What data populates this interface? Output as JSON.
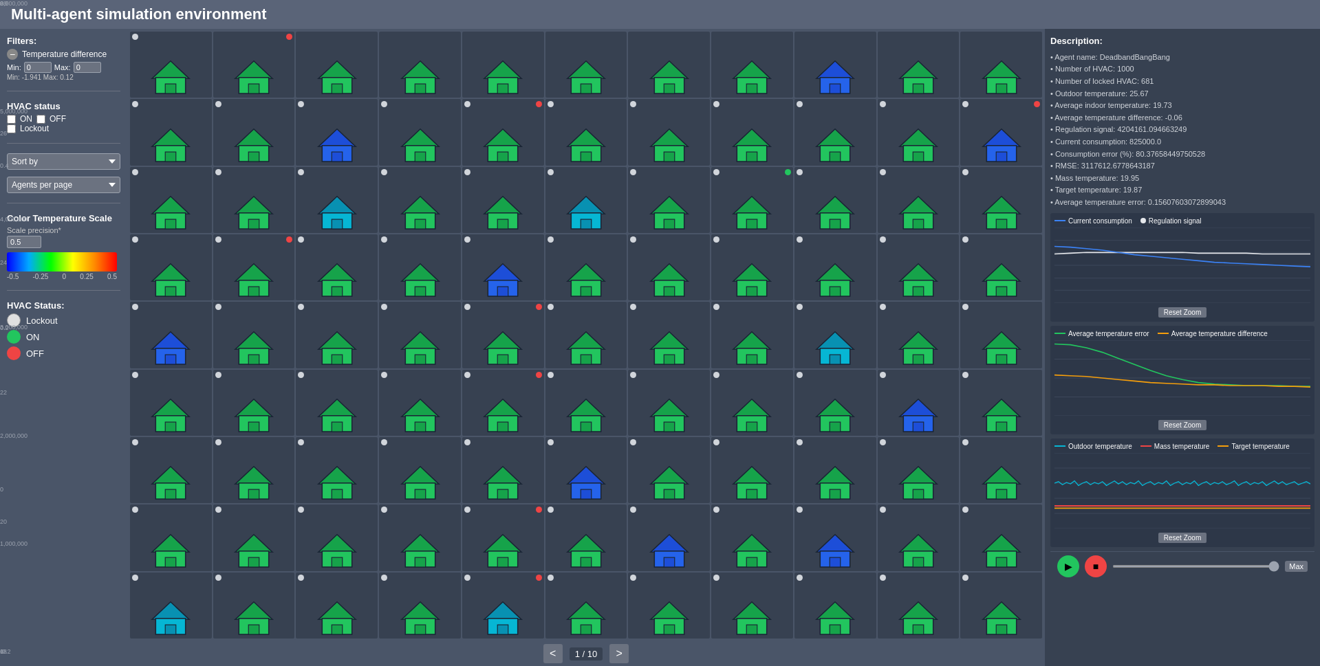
{
  "app": {
    "title": "Multi-agent simulation environment"
  },
  "filters": {
    "title": "Filters:",
    "temp_diff_label": "Temperature difference",
    "min_label": "Min:",
    "max_label": "Max:",
    "min_value": "0",
    "max_value": "0",
    "range_text": "Min: -1.941  Max: 0.12",
    "hvac_status_label": "HVAC status",
    "on_label": "ON",
    "off_label": "OFF",
    "lockout_label": "Lockout"
  },
  "sort": {
    "label": "Sort by",
    "placeholder": "Sort by"
  },
  "agents_per_page": {
    "label": "Agents per page",
    "placeholder": "Agents per page"
  },
  "color_scale": {
    "title": "Color Temperature Scale",
    "precision_label": "Scale precision*",
    "precision_value": "0.5",
    "scale_min": "-0.5",
    "scale_minus_quarter": "-0.25",
    "scale_zero": "0",
    "scale_quarter": "0.25",
    "scale_max": "0.5"
  },
  "hvac_status": {
    "title": "HVAC Status:",
    "lockout_label": "Lockout",
    "on_label": "ON",
    "off_label": "OFF"
  },
  "description": {
    "title": "Description:",
    "items": [
      "Agent name: DeadbandBangBang",
      "Number of HVAC: 1000",
      "Number of locked HVAC: 681",
      "Outdoor temperature: 25.67",
      "Average indoor temperature: 19.73",
      "Average temperature difference: -0.06",
      "Regulation signal: 4204161.094663249",
      "Current consumption: 825000.0",
      "Consumption error (%): 80.37658449750528",
      "RMSE: 3117612.6778643187",
      "Mass temperature: 19.95",
      "Target temperature: 19.87",
      "Average temperature error: 0.15607603072899043"
    ]
  },
  "chart1": {
    "legend": [
      {
        "label": "Current consumption",
        "color": "#3b82f6",
        "type": "line"
      },
      {
        "label": "Regulation signal",
        "color": "#e5e7eb",
        "type": "square"
      }
    ],
    "y_labels": [
      "6,000,000",
      "5,000,000",
      "4,000,000",
      "3,000,000",
      "2,000,000",
      "1,000,000",
      "0"
    ],
    "reset_zoom": "Reset Zoom"
  },
  "chart2": {
    "legend": [
      {
        "label": "Average temperature error",
        "color": "#22c55e",
        "type": "line"
      },
      {
        "label": "Average temperature difference",
        "color": "#f59e0b",
        "type": "line"
      }
    ],
    "y_labels": [
      "0.6",
      "0.4",
      "0.2",
      "0",
      "-0.2"
    ],
    "reset_zoom": "Reset Zoom"
  },
  "chart3": {
    "legend": [
      {
        "label": "Outdoor temperature",
        "color": "#06b6d4",
        "type": "line"
      },
      {
        "label": "Mass temperature",
        "color": "#ef4444",
        "type": "line"
      },
      {
        "label": "Target temperature",
        "color": "#f59e0b",
        "type": "line"
      }
    ],
    "y_labels": [
      "28",
      "26",
      "24",
      "22",
      "20",
      "18"
    ],
    "reset_zoom": "Reset Zoom"
  },
  "pagination": {
    "prev": "<",
    "next": ">",
    "current": "1",
    "total": "10",
    "separator": "/"
  },
  "playback": {
    "play_icon": "▶",
    "stop_icon": "■",
    "speed_label": "Max"
  },
  "grid": {
    "rows": 9,
    "cols": 11,
    "cells": [
      {
        "dot_left": "white",
        "dot_right": "none",
        "color": "green"
      },
      {
        "dot_left": "none",
        "dot_right": "red",
        "color": "green"
      },
      {
        "dot_left": "none",
        "dot_right": "none",
        "color": "green"
      },
      {
        "dot_left": "none",
        "dot_right": "none",
        "color": "green"
      },
      {
        "dot_left": "none",
        "dot_right": "none",
        "color": "green"
      },
      {
        "dot_left": "none",
        "dot_right": "none",
        "color": "green"
      },
      {
        "dot_left": "none",
        "dot_right": "none",
        "color": "green"
      },
      {
        "dot_left": "none",
        "dot_right": "none",
        "color": "green"
      },
      {
        "dot_left": "none",
        "dot_right": "none",
        "color": "blue"
      },
      {
        "dot_left": "none",
        "dot_right": "none",
        "color": "green"
      },
      {
        "dot_left": "none",
        "dot_right": "none",
        "color": "green"
      },
      {
        "dot_left": "white",
        "dot_right": "none",
        "color": "green"
      },
      {
        "dot_left": "white",
        "dot_right": "none",
        "color": "green"
      },
      {
        "dot_left": "white",
        "dot_right": "none",
        "color": "blue"
      },
      {
        "dot_left": "white",
        "dot_right": "none",
        "color": "green"
      },
      {
        "dot_left": "white",
        "dot_right": "red",
        "color": "green"
      },
      {
        "dot_left": "white",
        "dot_right": "none",
        "color": "green"
      },
      {
        "dot_left": "white",
        "dot_right": "none",
        "color": "green"
      },
      {
        "dot_left": "white",
        "dot_right": "none",
        "color": "green"
      },
      {
        "dot_left": "white",
        "dot_right": "none",
        "color": "green"
      },
      {
        "dot_left": "white",
        "dot_right": "none",
        "color": "green"
      },
      {
        "dot_left": "white",
        "dot_right": "red",
        "color": "blue"
      },
      {
        "dot_left": "white",
        "dot_right": "none",
        "color": "green"
      },
      {
        "dot_left": "white",
        "dot_right": "none",
        "color": "green"
      },
      {
        "dot_left": "white",
        "dot_right": "none",
        "color": "cyan"
      },
      {
        "dot_left": "white",
        "dot_right": "none",
        "color": "green"
      },
      {
        "dot_left": "white",
        "dot_right": "none",
        "color": "green"
      },
      {
        "dot_left": "white",
        "dot_right": "none",
        "color": "cyan"
      },
      {
        "dot_left": "white",
        "dot_right": "none",
        "color": "green"
      },
      {
        "dot_left": "white",
        "dot_right": "green",
        "color": "green"
      },
      {
        "dot_left": "white",
        "dot_right": "none",
        "color": "green"
      },
      {
        "dot_left": "white",
        "dot_right": "none",
        "color": "green"
      },
      {
        "dot_left": "white",
        "dot_right": "none",
        "color": "green"
      },
      {
        "dot_left": "white",
        "dot_right": "none",
        "color": "green"
      },
      {
        "dot_left": "white",
        "dot_right": "red",
        "color": "green"
      },
      {
        "dot_left": "white",
        "dot_right": "none",
        "color": "green"
      },
      {
        "dot_left": "white",
        "dot_right": "none",
        "color": "green"
      },
      {
        "dot_left": "white",
        "dot_right": "none",
        "color": "blue"
      },
      {
        "dot_left": "white",
        "dot_right": "none",
        "color": "green"
      },
      {
        "dot_left": "white",
        "dot_right": "none",
        "color": "green"
      },
      {
        "dot_left": "white",
        "dot_right": "none",
        "color": "green"
      },
      {
        "dot_left": "white",
        "dot_right": "none",
        "color": "green"
      },
      {
        "dot_left": "white",
        "dot_right": "none",
        "color": "green"
      },
      {
        "dot_left": "white",
        "dot_right": "none",
        "color": "green"
      },
      {
        "dot_left": "white",
        "dot_right": "none",
        "color": "blue"
      },
      {
        "dot_left": "white",
        "dot_right": "none",
        "color": "green"
      },
      {
        "dot_left": "white",
        "dot_right": "none",
        "color": "green"
      },
      {
        "dot_left": "white",
        "dot_right": "none",
        "color": "green"
      },
      {
        "dot_left": "white",
        "dot_right": "red",
        "color": "green"
      },
      {
        "dot_left": "white",
        "dot_right": "none",
        "color": "green"
      },
      {
        "dot_left": "white",
        "dot_right": "none",
        "color": "green"
      },
      {
        "dot_left": "white",
        "dot_right": "none",
        "color": "green"
      },
      {
        "dot_left": "white",
        "dot_right": "none",
        "color": "cyan"
      },
      {
        "dot_left": "white",
        "dot_right": "none",
        "color": "green"
      },
      {
        "dot_left": "white",
        "dot_right": "none",
        "color": "green"
      },
      {
        "dot_left": "white",
        "dot_right": "none",
        "color": "green"
      },
      {
        "dot_left": "white",
        "dot_right": "none",
        "color": "green"
      },
      {
        "dot_left": "white",
        "dot_right": "none",
        "color": "green"
      },
      {
        "dot_left": "white",
        "dot_right": "none",
        "color": "green"
      },
      {
        "dot_left": "white",
        "dot_right": "red",
        "color": "green"
      },
      {
        "dot_left": "white",
        "dot_right": "none",
        "color": "green"
      },
      {
        "dot_left": "white",
        "dot_right": "none",
        "color": "green"
      },
      {
        "dot_left": "white",
        "dot_right": "none",
        "color": "green"
      },
      {
        "dot_left": "white",
        "dot_right": "none",
        "color": "green"
      },
      {
        "dot_left": "white",
        "dot_right": "none",
        "color": "blue"
      },
      {
        "dot_left": "white",
        "dot_right": "none",
        "color": "green"
      },
      {
        "dot_left": "white",
        "dot_right": "none",
        "color": "green"
      },
      {
        "dot_left": "white",
        "dot_right": "none",
        "color": "green"
      },
      {
        "dot_left": "white",
        "dot_right": "none",
        "color": "green"
      },
      {
        "dot_left": "white",
        "dot_right": "none",
        "color": "green"
      },
      {
        "dot_left": "white",
        "dot_right": "none",
        "color": "green"
      },
      {
        "dot_left": "white",
        "dot_right": "none",
        "color": "blue"
      },
      {
        "dot_left": "white",
        "dot_right": "none",
        "color": "green"
      },
      {
        "dot_left": "white",
        "dot_right": "none",
        "color": "green"
      },
      {
        "dot_left": "white",
        "dot_right": "none",
        "color": "green"
      },
      {
        "dot_left": "white",
        "dot_right": "none",
        "color": "green"
      },
      {
        "dot_left": "white",
        "dot_right": "none",
        "color": "green"
      },
      {
        "dot_left": "white",
        "dot_right": "none",
        "color": "green"
      },
      {
        "dot_left": "white",
        "dot_right": "none",
        "color": "green"
      },
      {
        "dot_left": "white",
        "dot_right": "none",
        "color": "green"
      },
      {
        "dot_left": "white",
        "dot_right": "none",
        "color": "green"
      },
      {
        "dot_left": "white",
        "dot_right": "red",
        "color": "green"
      },
      {
        "dot_left": "white",
        "dot_right": "none",
        "color": "green"
      },
      {
        "dot_left": "white",
        "dot_right": "none",
        "color": "blue"
      },
      {
        "dot_left": "white",
        "dot_right": "none",
        "color": "green"
      },
      {
        "dot_left": "white",
        "dot_right": "none",
        "color": "blue"
      },
      {
        "dot_left": "white",
        "dot_right": "none",
        "color": "green"
      },
      {
        "dot_left": "white",
        "dot_right": "none",
        "color": "green"
      },
      {
        "dot_left": "white",
        "dot_right": "none",
        "color": "cyan"
      },
      {
        "dot_left": "white",
        "dot_right": "none",
        "color": "green"
      },
      {
        "dot_left": "white",
        "dot_right": "none",
        "color": "green"
      },
      {
        "dot_left": "white",
        "dot_right": "none",
        "color": "green"
      },
      {
        "dot_left": "white",
        "dot_right": "red",
        "color": "cyan"
      },
      {
        "dot_left": "white",
        "dot_right": "none",
        "color": "green"
      },
      {
        "dot_left": "white",
        "dot_right": "none",
        "color": "green"
      },
      {
        "dot_left": "white",
        "dot_right": "none",
        "color": "green"
      },
      {
        "dot_left": "white",
        "dot_right": "none",
        "color": "green"
      },
      {
        "dot_left": "white",
        "dot_right": "none",
        "color": "green"
      },
      {
        "dot_left": "white",
        "dot_right": "none",
        "color": "green"
      }
    ]
  }
}
